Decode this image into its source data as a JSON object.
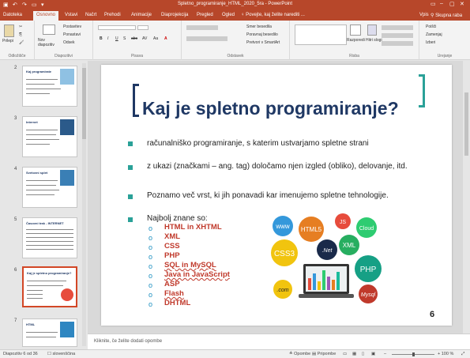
{
  "window": {
    "title": "Spletno_programiranje_HTML_2020_5ra - PowerPoint",
    "controls": [
      "▭",
      "–",
      "▢",
      "✕"
    ],
    "sign_in": "Vpis",
    "share": "Skupna raba"
  },
  "tabs": [
    "Datoteka",
    "Osnovno",
    "Vstavi",
    "Načrt",
    "Prehodi",
    "Animacije",
    "Diaprojekcija",
    "Pregled",
    "Ogled"
  ],
  "tell_me": "Povejte, kaj želite narediti ...",
  "ribbon": {
    "groups": [
      {
        "label": "Odložišče",
        "buttons": [
          "Prilepi"
        ]
      },
      {
        "label": "Diapozitivi",
        "buttons": [
          "Nov diapozitiv",
          "Postavitev",
          "Ponastavi",
          "Odsek"
        ]
      },
      {
        "label": "Pisava",
        "buttons": [
          "B",
          "I",
          "U",
          "S",
          "abc",
          "AV",
          "Aa",
          "A"
        ]
      },
      {
        "label": "Odstavek",
        "buttons": [
          "Smer besedila",
          "Poravnaj besedilo",
          "Pretvori v SmartArt"
        ]
      },
      {
        "label": "Risba",
        "buttons": [
          "Razporedi",
          "Hitri slogi"
        ]
      },
      {
        "label": "Urejanje",
        "buttons": [
          "Poišči",
          "Zamenjaj",
          "Izberi"
        ]
      }
    ]
  },
  "thumbnails": [
    {
      "num": "2",
      "title": "Kaj  programirate"
    },
    {
      "num": "3",
      "title": "Internet"
    },
    {
      "num": "4",
      "title": "Svetovni splet"
    },
    {
      "num": "5",
      "title": "Časovni trak - INTERNET"
    },
    {
      "num": "6",
      "title": "Kaj je spletno programiranje?"
    },
    {
      "num": "7",
      "title": "HTML"
    }
  ],
  "slide": {
    "title": "Kaj je spletno programiranje?",
    "bullets": [
      "računalniško programiranje, s katerim ustvarjamo spletne strani",
      "z ukazi (značkami – ang. tag) določamo njen izgled (obliko), delovanje, itd.",
      "Poznamo več vrst, ki jih ponavadi kar imenujemo spletne tehnologije.",
      "Najbolj znane so:"
    ],
    "sublist": [
      "HTML in XHTML",
      "XML",
      "CSS",
      "PHP",
      "SQL in MySQL",
      "Java in JavaScript",
      "ASP",
      "Flash",
      "DHTML"
    ],
    "sub_marker": "o",
    "bubbles": [
      "www",
      "HTML5",
      "JS",
      "Cloud",
      "CSS3",
      ".Net",
      "XML",
      "PHP",
      ".com",
      "Mysql"
    ],
    "number": "6"
  },
  "notes_placeholder": "Kliknite, če želite dodati opombe",
  "status": {
    "slide_info": "Diapozitiv 6 od 36",
    "language": "slovenščina",
    "notes": "Opombe",
    "comments": "Pripombe",
    "zoom": "+ 100 %"
  },
  "colors": {
    "accent": "#b7472a",
    "title": "#1f3864",
    "teal": "#2aa198",
    "sub": "#c0392b"
  }
}
